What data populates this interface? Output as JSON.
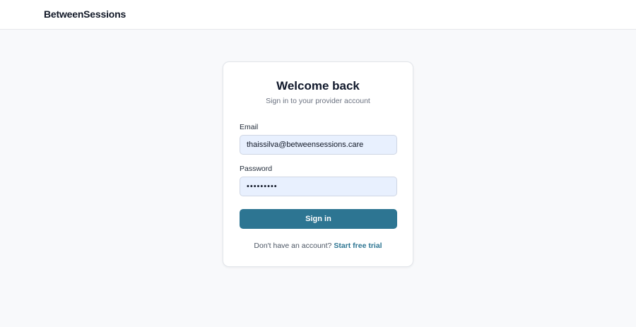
{
  "header": {
    "brand": "BetweenSessions"
  },
  "login": {
    "title": "Welcome back",
    "subtitle": "Sign in to your provider account",
    "email_label": "Email",
    "email_value": "thaissilva@betweensessions.care",
    "password_label": "Password",
    "password_value": "•••••••••",
    "submit_label": "Sign in",
    "footer_text": "Don't have an account?",
    "footer_link": "Start free trial"
  },
  "colors": {
    "accent": "#2d7592",
    "input_fill": "#e8f0fe",
    "background": "#f8f9fb"
  }
}
